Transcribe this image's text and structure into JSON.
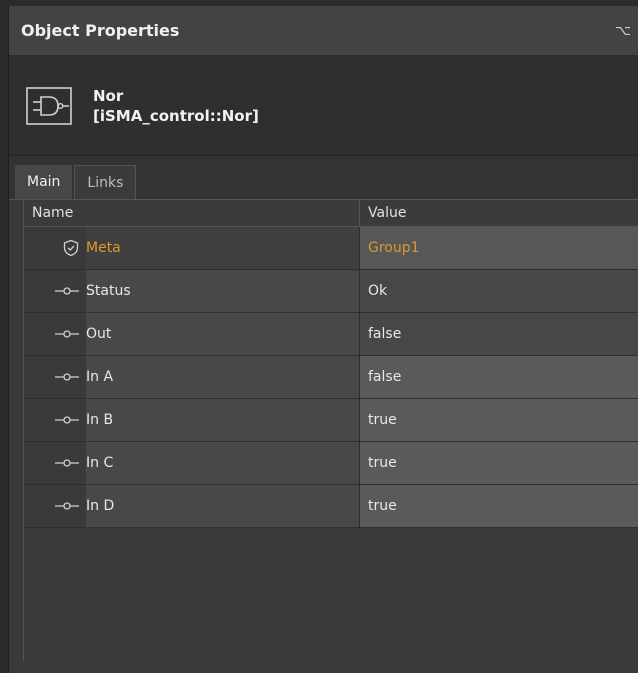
{
  "panel": {
    "title": "Object Properties",
    "pin_icon": "pin-icon",
    "pin_glyph": "⌥"
  },
  "object": {
    "icon": "nor-gate-icon",
    "name": "Nor",
    "type": "[iSMA_control::Nor]"
  },
  "tabs": [
    {
      "label": "Main",
      "active": true
    },
    {
      "label": "Links",
      "active": false
    }
  ],
  "table": {
    "columns": [
      "Name",
      "Value"
    ],
    "rows": [
      {
        "icon": "shield-icon",
        "name": "Meta",
        "value": "Group1"
      },
      {
        "icon": "slot-icon",
        "name": "Status",
        "value": "Ok"
      },
      {
        "icon": "slot-icon",
        "name": "Out",
        "value": "false"
      },
      {
        "icon": "slot-icon",
        "name": "In A",
        "value": "false"
      },
      {
        "icon": "slot-icon",
        "name": "In B",
        "value": "true"
      },
      {
        "icon": "slot-icon",
        "name": "In C",
        "value": "true"
      },
      {
        "icon": "slot-icon",
        "name": "In D",
        "value": "true"
      }
    ]
  },
  "colors": {
    "meta_accent": "#d99a2a",
    "panel_bg": "#3a3a3a",
    "title_bg": "#434343"
  }
}
